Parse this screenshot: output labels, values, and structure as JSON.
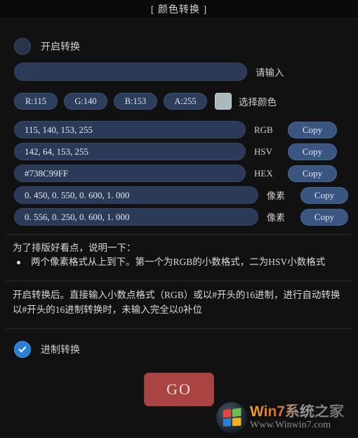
{
  "window": {
    "title": "[ 颜色转换 ]"
  },
  "enable_toggle": {
    "label": "开启转换",
    "checked": false
  },
  "main_input": {
    "value": "",
    "placeholder": "",
    "suffix_label": "请输入"
  },
  "channels": [
    {
      "label": "R:115"
    },
    {
      "label": "G:140"
    },
    {
      "label": "B:153"
    },
    {
      "label": "A:255"
    }
  ],
  "color_picker": {
    "label": "选择颜色",
    "swatch_color": "#a9b9be"
  },
  "value_rows": [
    {
      "value": "115, 140, 153, 255",
      "tag": "RGB",
      "copy_label": "Copy"
    },
    {
      "value": "142, 64, 153, 255",
      "tag": "HSV",
      "copy_label": "Copy"
    },
    {
      "value": "#738C99FF",
      "tag": "HEX",
      "copy_label": "Copy"
    },
    {
      "value": "0. 450, 0. 550, 0. 600, 1. 000",
      "tag": "像素",
      "copy_label": "Copy"
    },
    {
      "value": "0. 556, 0. 250, 0. 600, 1. 000",
      "tag": "像素",
      "copy_label": "Copy"
    }
  ],
  "notes": {
    "block1_line1": "为了排版好看点，说明一下：",
    "block1_bullet": "两个像素格式从上到下。第一个为RGB的小数格式，二为HSV小数格式",
    "block2_line1": "开启转换后。直接输入小数点格式（RGB）或以#开头的16进制，进行自动转换",
    "block2_line2": "以#开头的16进制转换时，未输入完全以0补位"
  },
  "bottom_toggle": {
    "label": "进制转换",
    "checked": true
  },
  "go_button": {
    "label": "GO"
  },
  "watermark": {
    "main": "Win7系统之家",
    "sub": "Www.Winwin7.com"
  },
  "colors": {
    "background": "#111111",
    "field": "#2b3a57",
    "copy_button": "#3a5680",
    "accent_check": "#2a7fd4",
    "go_button": "#a94442"
  }
}
